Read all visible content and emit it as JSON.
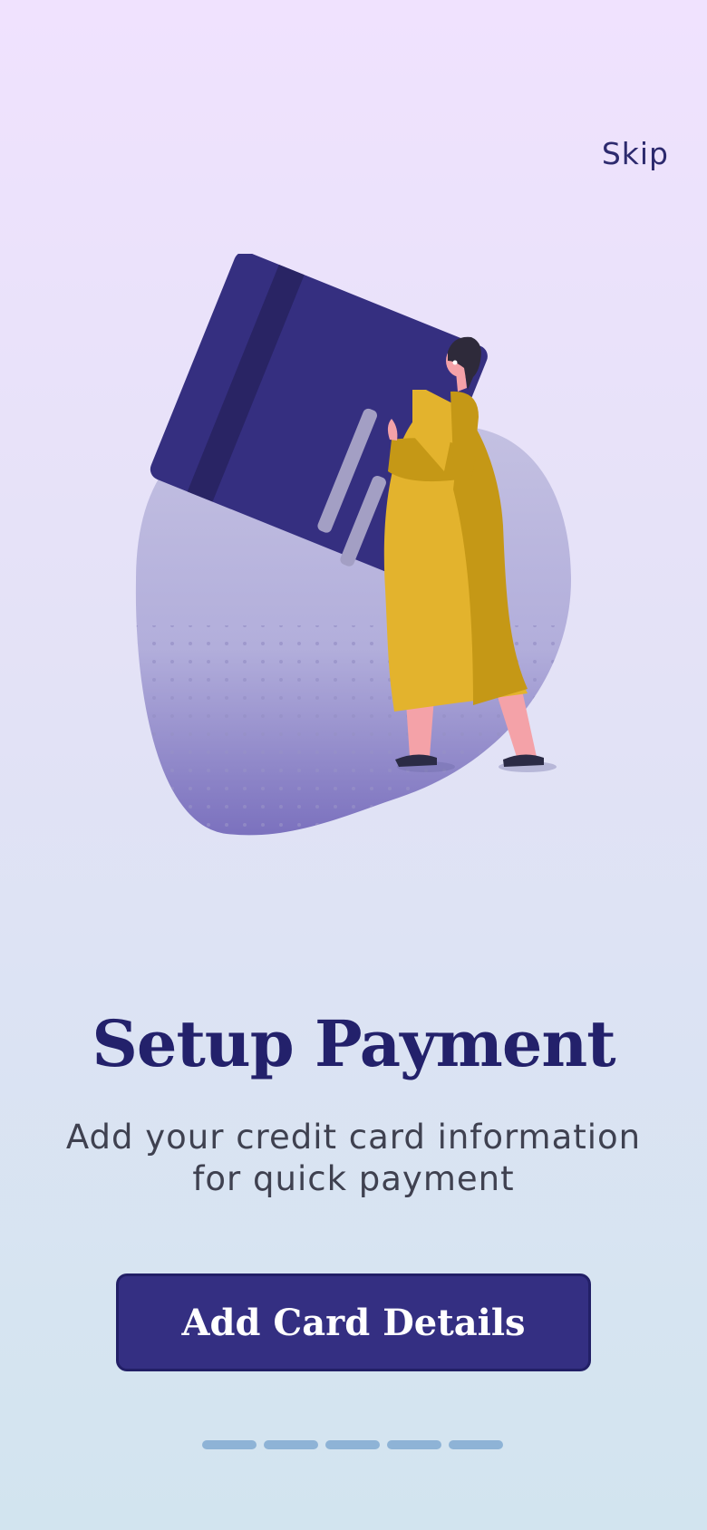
{
  "header": {
    "skip_label": "Skip"
  },
  "illustration": {
    "icon": "credit-card-illustration",
    "blob_color": "#b9b5dc",
    "card_color": "#352f80",
    "coat_color": "#e3b32d"
  },
  "content": {
    "title": "Setup Payment",
    "subtitle": "Add your credit card information for quick payment"
  },
  "cta": {
    "label": "Add Card Details",
    "color": "#342f82"
  },
  "pagination": {
    "pages": 5
  }
}
